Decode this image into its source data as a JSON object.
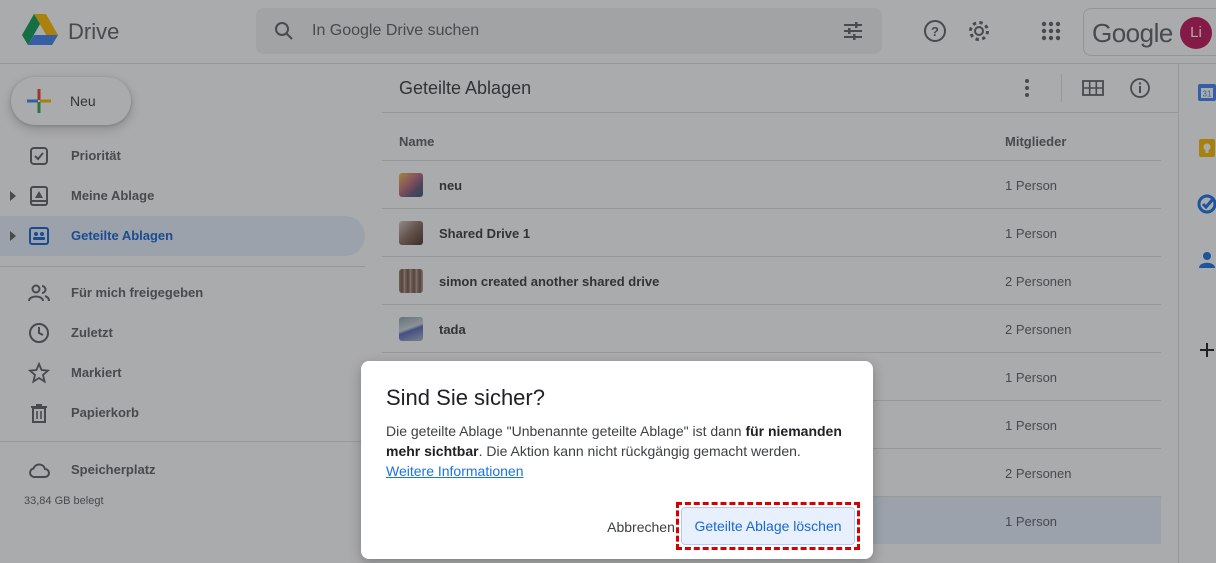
{
  "header": {
    "app_name": "Drive",
    "search_placeholder": "In Google Drive suchen",
    "google_label": "Google",
    "avatar_initials": "Li",
    "icons": [
      "drive-logo-icon",
      "search-icon",
      "tune-icon",
      "help-icon",
      "gear-icon",
      "apps-icon"
    ]
  },
  "sidebar": {
    "new_label": "Neu",
    "items": [
      {
        "label": "Priorität",
        "icon": "priority-icon"
      },
      {
        "label": "Meine Ablage",
        "icon": "my-drive-icon"
      },
      {
        "label": "Geteilte Ablagen",
        "icon": "shared-drives-icon"
      },
      {
        "label": "Für mich freigegeben",
        "icon": "people-icon"
      },
      {
        "label": "Zuletzt",
        "icon": "clock-icon"
      },
      {
        "label": "Markiert",
        "icon": "star-icon"
      },
      {
        "label": "Papierkorb",
        "icon": "trash-icon"
      }
    ],
    "storage_label": "Speicherplatz",
    "storage_used": "33,84 GB belegt"
  },
  "main": {
    "title": "Geteilte Ablagen",
    "columns": {
      "name": "Name",
      "members": "Mitglieder"
    },
    "rows": [
      {
        "name": "neu",
        "members": "1 Person"
      },
      {
        "name": "Shared Drive 1",
        "members": "1 Person"
      },
      {
        "name": "simon created another shared drive",
        "members": "2 Personen"
      },
      {
        "name": "tada",
        "members": "2 Personen"
      },
      {
        "name": "",
        "members": "1 Person"
      },
      {
        "name": "",
        "members": "1 Person"
      },
      {
        "name": "",
        "members": "2 Personen"
      },
      {
        "name": "",
        "members": "1 Person"
      }
    ]
  },
  "dialog": {
    "title": "Sind Sie sicher?",
    "body_pre": "Die geteilte Ablage \"Unbenannte geteilte Ablage\" ist dann ",
    "body_bold": "für niemanden mehr sichtbar",
    "body_post": ". Die Aktion kann nicht rückgängig gemacht werden.",
    "link": "Weitere Informationen",
    "cancel_label": "Abbrechen",
    "confirm_label": "Geteilte Ablage löschen"
  },
  "colors": {
    "accent": "#1967d2",
    "active_bg": "#e8f0fe",
    "highlight_outline": "#d50000",
    "avatar": "#c2185b"
  }
}
